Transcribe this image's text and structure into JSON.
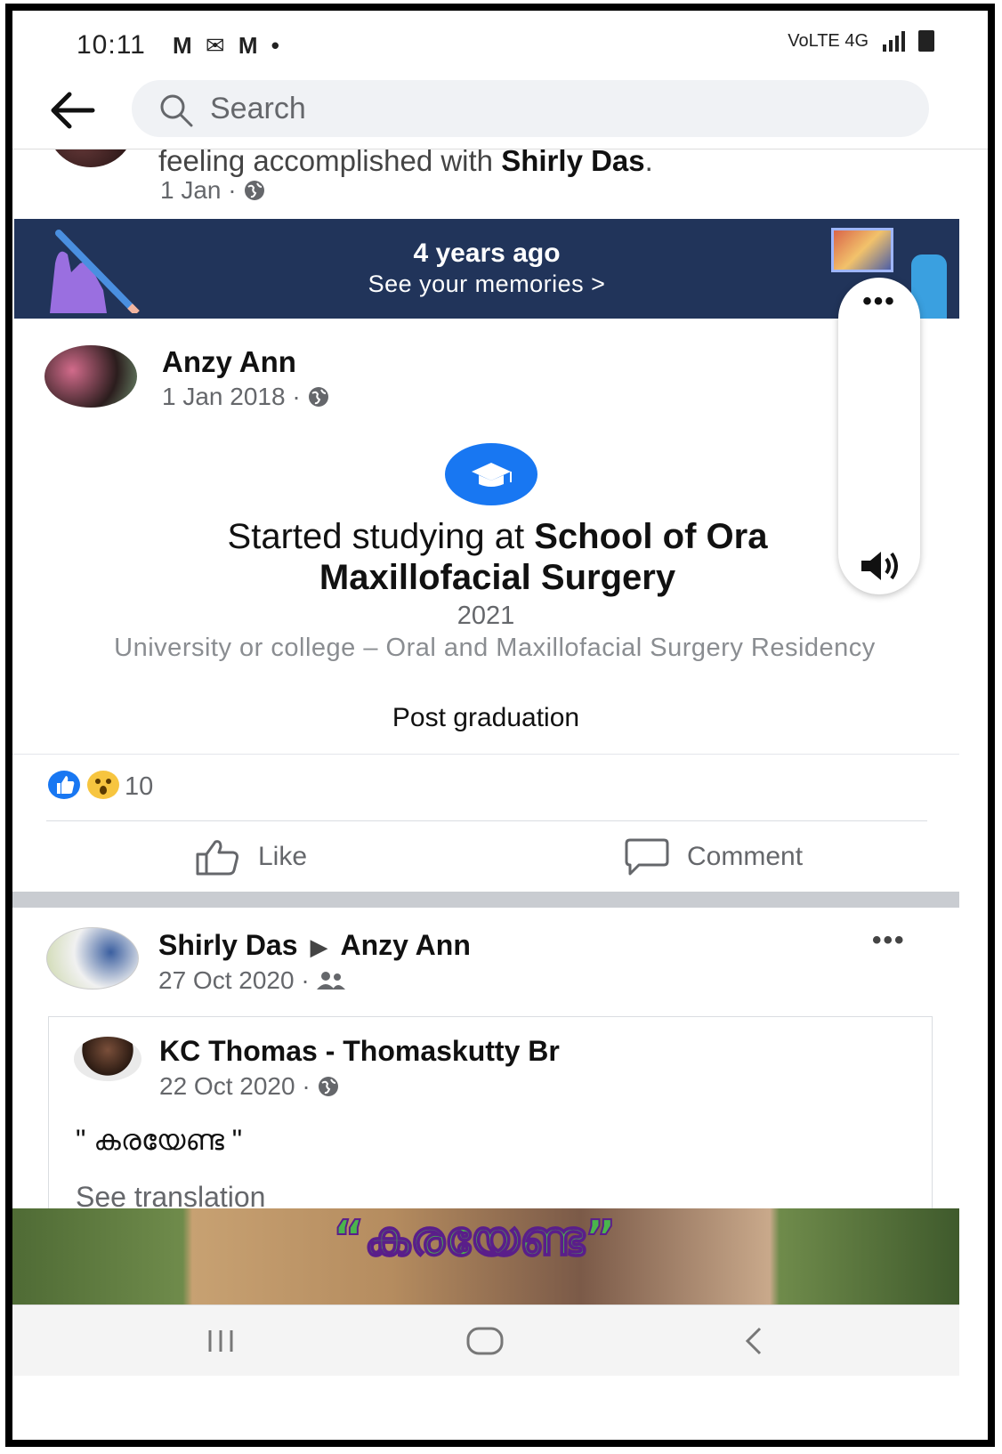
{
  "status_bar": {
    "time": "10:11",
    "notification_icons": "M ✉ M •",
    "network": "VoLTE 4G",
    "icons": [
      "gmail-icon",
      "message-icon",
      "gmail-icon",
      "dot-icon",
      "volte-icon",
      "signal-icon",
      "battery-icon"
    ]
  },
  "header": {
    "search_placeholder": "Search"
  },
  "previous_post": {
    "text_prefix": "feeling accomplished with ",
    "text_name": "Shirly Das",
    "text_suffix": ".",
    "date": "1 Jan · "
  },
  "memories": {
    "title": "4 years ago",
    "link": "See your memories >"
  },
  "floating_panel": {
    "more": "•••"
  },
  "post": {
    "author": "Anzy Ann",
    "date": "1 Jan 2018 · ",
    "headline_prefix": "Started studying at ",
    "headline_bold_1": "School of Ora",
    "headline_bold_2": "Maxillofacial Surgery",
    "year": "2021",
    "description": "University or college – Oral and Maxillofacial Surgery Residency",
    "level": "Post graduation",
    "reaction_count": "10"
  },
  "actions": {
    "like": "Like",
    "comment": "Comment"
  },
  "post2": {
    "author": "Shirly Das",
    "target": "Anzy Ann",
    "date": "27 Oct 2020 · ",
    "more": "•••",
    "shared": {
      "author": "KC Thomas - Thomaskutty Br",
      "date": "22 Oct 2020 · ",
      "quote": "\" കരയേണ്ട \"",
      "translate": "See translation"
    },
    "image_overlay": "“കരയേണ്ട”"
  },
  "colors": {
    "facebook_blue": "#1877f2",
    "banner_navy": "#21345a",
    "meta_grey": "#65676b"
  }
}
